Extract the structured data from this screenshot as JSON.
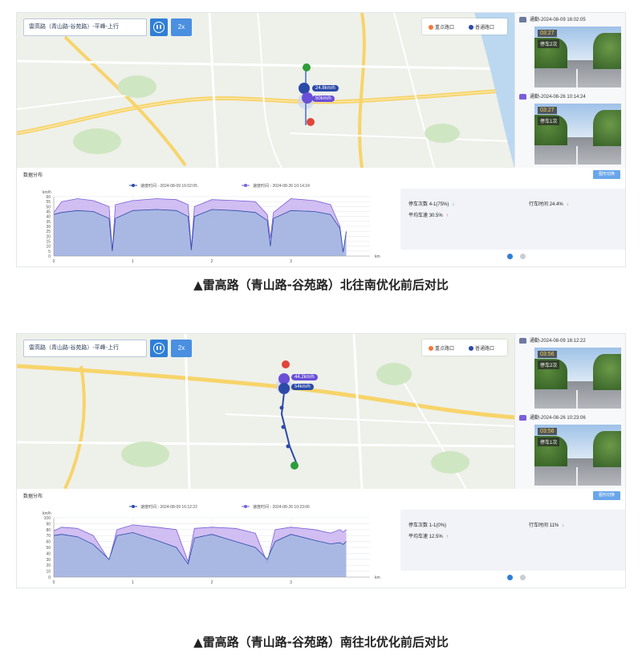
{
  "colors": {
    "accent": "#2f7fd6",
    "before": "#6a4fd8",
    "after": "#2b4aa8",
    "fill_before": "#b7a0ea",
    "fill_after": "#8eb4e0",
    "stop_down": "#2e9d3a",
    "speed_up": "#e0463a"
  },
  "panels": [
    {
      "route_label": "雷高路（青山路-谷苑路）-平峰-上行",
      "speed_button": "2x",
      "legend": {
        "key_intersection": "重点路口",
        "normal_intersection": "普通路口"
      },
      "speed_tag_1": "24.8km/h",
      "speed_tag_2": "50km/h",
      "snapshots": [
        {
          "header": "通勤-2024-08-09 16:02:05",
          "time": "03:27",
          "stop": "停车2次"
        },
        {
          "header": "通勤-2024-08-26 10:14:24",
          "time": "03:27",
          "stop": "停车1次"
        }
      ],
      "stats_title": "数据分布",
      "stats_button": "图形切换",
      "chart_legend": [
        "速度时间 - 2024-08-09 16:02:05",
        "速度时间 - 2024-08-26 10:14:24"
      ],
      "summary": {
        "stops_label": "停车次数",
        "stops_value": "4-1(75%)",
        "stops_arrow": "↓",
        "time_label": "行车时间",
        "time_value": "24.4%",
        "time_arrow": "↓",
        "avg_label": "平均车速",
        "avg_value": "30.5%",
        "avg_arrow": "↑"
      },
      "caption": "▲雷高路（青山路-谷苑路）北往南优化前后对比"
    },
    {
      "route_label": "雷高路（青山路-谷苑路）-平峰-上行",
      "speed_button": "2x",
      "legend": {
        "key_intersection": "重点路口",
        "normal_intersection": "普通路口"
      },
      "speed_tag_1": "44.2km/h",
      "speed_tag_2": "54km/h",
      "snapshots": [
        {
          "header": "通勤-2024-08-09 16:12:22",
          "time": "03:56",
          "stop": "停车2次"
        },
        {
          "header": "通勤-2024-08-26 10:23:06",
          "time": "03:56",
          "stop": "停车1次"
        }
      ],
      "stats_title": "数据分布",
      "stats_button": "图形切换",
      "chart_legend": [
        "速度时间 - 2024-08-09 16:12:22",
        "速度时间 - 2024-08-26 10:23:06"
      ],
      "summary": {
        "stops_label": "停车次数",
        "stops_value": "1-1(0%)",
        "stops_arrow": "",
        "time_label": "行车时间",
        "time_value": "11%",
        "time_arrow": "↓",
        "avg_label": "平均车速",
        "avg_value": "12.5%",
        "avg_arrow": "↑"
      },
      "caption": "▲雷高路（青山路-谷苑路）南往北优化前后对比"
    }
  ],
  "chart_data": [
    {
      "type": "area",
      "ylabel": "km/h",
      "xlabel": "km",
      "ylim": [
        0,
        60
      ],
      "yticks": [
        0,
        5,
        10,
        15,
        20,
        25,
        30,
        35,
        40,
        45,
        50,
        55,
        60
      ],
      "xticks": [
        0,
        1,
        2,
        3
      ],
      "x": [
        0,
        0.1,
        0.3,
        0.5,
        0.7,
        0.74,
        0.78,
        1.0,
        1.3,
        1.55,
        1.7,
        1.74,
        1.78,
        2.0,
        2.3,
        2.55,
        2.7,
        2.74,
        2.78,
        3.0,
        3.3,
        3.5,
        3.62,
        3.66,
        3.7
      ],
      "series": [
        {
          "name": "速度时间 - 2024-08-09 16:02:05",
          "values": [
            42,
            44,
            46,
            45,
            38,
            5,
            38,
            46,
            47,
            46,
            40,
            6,
            40,
            47,
            46,
            44,
            36,
            10,
            38,
            46,
            45,
            42,
            28,
            4,
            24
          ]
        },
        {
          "name": "速度时间 - 2024-08-26 10:14:24",
          "values": [
            44,
            55,
            58,
            56,
            50,
            5,
            52,
            56,
            58,
            57,
            52,
            8,
            50,
            57,
            56,
            55,
            42,
            18,
            44,
            58,
            56,
            52,
            30,
            4,
            25
          ]
        }
      ]
    },
    {
      "type": "area",
      "ylabel": "km/h",
      "xlabel": "km",
      "ylim": [
        0,
        100
      ],
      "yticks": [
        0,
        10,
        20,
        30,
        40,
        50,
        60,
        70,
        80,
        90,
        100
      ],
      "xticks": [
        0,
        1,
        2,
        3
      ],
      "x": [
        0,
        0.1,
        0.3,
        0.5,
        0.7,
        0.8,
        1.0,
        1.3,
        1.55,
        1.7,
        1.78,
        2.0,
        2.3,
        2.55,
        2.7,
        2.8,
        3.0,
        3.3,
        3.5,
        3.62,
        3.66,
        3.7
      ],
      "series": [
        {
          "name": "速度时间 - 2024-08-09 16:12:22",
          "values": [
            70,
            72,
            68,
            55,
            30,
            70,
            75,
            62,
            50,
            22,
            66,
            72,
            60,
            50,
            30,
            60,
            72,
            62,
            56,
            58,
            55,
            60
          ]
        },
        {
          "name": "速度时间 - 2024-08-26 10:23:06",
          "values": [
            78,
            84,
            82,
            70,
            28,
            80,
            88,
            84,
            80,
            26,
            82,
            84,
            82,
            74,
            24,
            80,
            84,
            80,
            74,
            80,
            76,
            80
          ]
        }
      ]
    }
  ]
}
